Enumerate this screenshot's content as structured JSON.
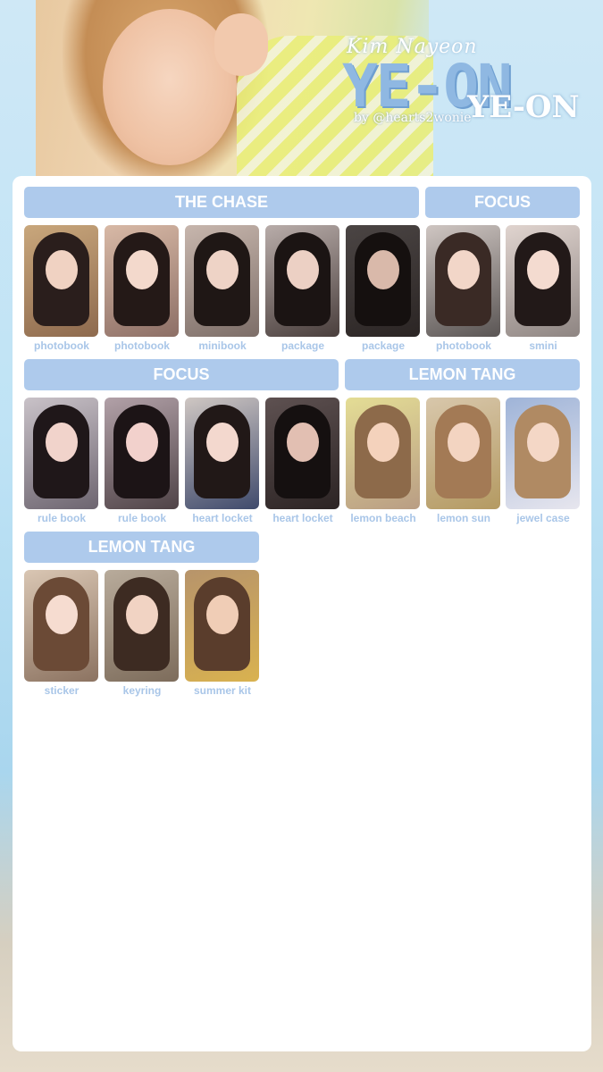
{
  "header": {
    "subtitle": "Kim Nayeon",
    "title": "YE-ON",
    "title_echo": "YE-ON",
    "credit": "by @hearts2wonie"
  },
  "colors": {
    "banner": "#aecaec",
    "caption": "#a9c6e8",
    "board": "#ffffff"
  },
  "sections": [
    {
      "title": "THE CHASE"
    },
    {
      "title": "FOCUS"
    },
    {
      "title": "FOCUS"
    },
    {
      "title": "LEMON TANG"
    },
    {
      "title": "LEMON TANG"
    }
  ],
  "cards": [
    {
      "label": "photobook"
    },
    {
      "label": "photobook"
    },
    {
      "label": "minibook"
    },
    {
      "label": "package"
    },
    {
      "label": "package"
    },
    {
      "label": "photobook"
    },
    {
      "label": "smini"
    },
    {
      "label": "rule book"
    },
    {
      "label": "rule book"
    },
    {
      "label": "heart locket"
    },
    {
      "label": "heart locket"
    },
    {
      "label": "lemon beach"
    },
    {
      "label": "lemon sun"
    },
    {
      "label": "jewel case"
    },
    {
      "label": "sticker"
    },
    {
      "label": "keyring"
    },
    {
      "label": "summer kit"
    }
  ]
}
